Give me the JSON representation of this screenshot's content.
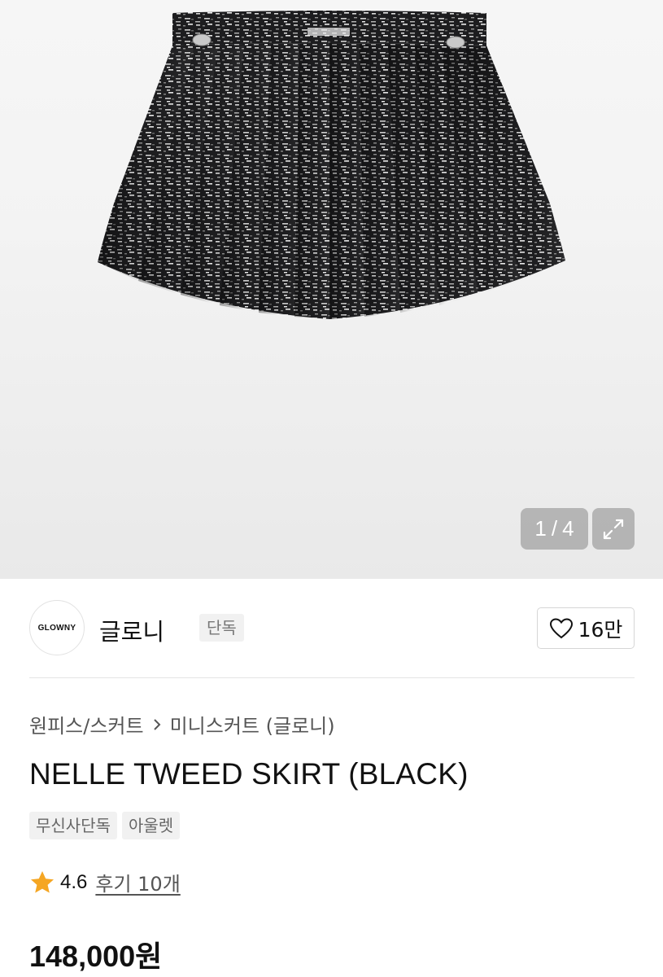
{
  "gallery": {
    "current_page": "1",
    "separator": "/",
    "total_pages": "4",
    "expand_icon": "expand-arrows-icon"
  },
  "brand": {
    "logo_text": "GLOWNY",
    "name": "글로니",
    "badge": "단독"
  },
  "like": {
    "icon": "heart-outline-icon",
    "count": "16만"
  },
  "breadcrumb": {
    "category": "원피스/스커트",
    "chevron_icon": "chevron-right-icon",
    "subcategory": "미니스커트 (글로니)"
  },
  "product": {
    "title": "NELLE TWEED SKIRT (BLACK)",
    "tags": [
      "무신사단독",
      "아울렛"
    ],
    "rating": "4.6",
    "rating_icon": "star-icon",
    "reviews_label": "후기 10개",
    "price": "148,000원"
  },
  "colors": {
    "star": "#f5a623",
    "counter_bg": "#a0a0a0",
    "tag_bg": "#f1f1f1"
  }
}
